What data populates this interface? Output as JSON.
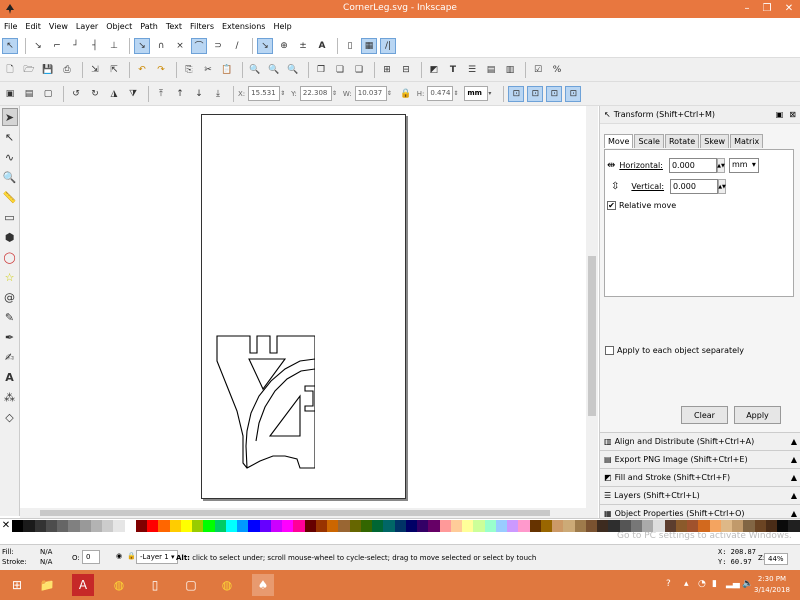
{
  "titlebar": {
    "title": "CornerLeg.svg - Inkscape",
    "minimize_icon": "minimize-icon",
    "maximize_icon": "restore-icon",
    "close_icon": "close-icon"
  },
  "menubar": {
    "items": [
      "File",
      "Edit",
      "View",
      "Layer",
      "Object",
      "Path",
      "Text",
      "Filters",
      "Extensions",
      "Help"
    ]
  },
  "tool_controls": {
    "x_label": "X:",
    "x_value": "15.531",
    "y_label": "Y:",
    "y_value": "22.308",
    "w_label": "W:",
    "w_value": "10.037",
    "h_label": "H:",
    "h_value": "0.474",
    "unit": "mm"
  },
  "transform_panel": {
    "title": "Transform (Shift+Ctrl+M)",
    "tabs": [
      "Move",
      "Scale",
      "Rotate",
      "Skew",
      "Matrix"
    ],
    "selected_tab": "Move",
    "horizontal_label": "Horizontal:",
    "horizontal_value": "0.000",
    "vertical_label": "Vertical:",
    "vertical_value": "0.000",
    "unit": "mm",
    "relative_move_label": "Relative move",
    "relative_move_checked": true,
    "apply_each_label": "Apply to each object separately",
    "apply_each_checked": false,
    "clear_label": "Clear",
    "apply_label": "Apply"
  },
  "docked_dialogs": [
    "Align and Distribute (Shift+Ctrl+A)",
    "Export PNG Image (Shift+Ctrl+E)",
    "Fill and Stroke (Shift+Ctrl+F)",
    "Layers (Shift+Ctrl+L)",
    "Object Properties (Shift+Ctrl+O)"
  ],
  "watermark": "Go to PC settings to activate Windows.",
  "statusbar": {
    "fill_label": "Fill:",
    "fill_value": "N/A",
    "stroke_label": "Stroke:",
    "stroke_value": "N/A",
    "opacity_label": "O:",
    "opacity_value": "0",
    "layer": "-Layer 1",
    "message_bold": "Alt:",
    "message": " click to select under; scroll mouse-wheel to cycle-select; drag to move selected or select by touch",
    "x_coord": "X:  208.87",
    "y_coord": "Y:   60.97",
    "zoom_label": "Z:",
    "zoom_value": "44%"
  },
  "taskbar": {
    "time": "2:30 PM",
    "date": "3/14/2018"
  },
  "palette_colors": [
    "#000000",
    "#1a1a1a",
    "#333333",
    "#4d4d4d",
    "#666666",
    "#808080",
    "#999999",
    "#b3b3b3",
    "#cccccc",
    "#e6e6e6",
    "#ffffff",
    "#800000",
    "#ff0000",
    "#ff6600",
    "#ffcc00",
    "#ffff00",
    "#99cc00",
    "#00ff00",
    "#00cc66",
    "#00ffff",
    "#0099ff",
    "#0000ff",
    "#6600ff",
    "#cc00ff",
    "#ff00ff",
    "#ff0099",
    "#660000",
    "#993300",
    "#cc6600",
    "#996633",
    "#666600",
    "#336600",
    "#006633",
    "#006666",
    "#003366",
    "#000066",
    "#330066",
    "#660066",
    "#ff9999",
    "#ffcc99",
    "#ffff99",
    "#ccff99",
    "#99ffcc",
    "#99ccff",
    "#cc99ff",
    "#ff99cc",
    "#663300",
    "#996600",
    "#cc9966",
    "#ccaa77",
    "#9e7b4b",
    "#7a5230",
    "#3d2b1f",
    "#2e2e2e",
    "#555555",
    "#777777",
    "#aaaaaa",
    "#dddddd",
    "#5c3d2e",
    "#8b5a2b",
    "#a0522d",
    "#d2691e",
    "#f4a460",
    "#deb887",
    "#c19a6b",
    "#826644",
    "#6b4423",
    "#4a2c17",
    "#0a0a0a",
    "#202020"
  ]
}
